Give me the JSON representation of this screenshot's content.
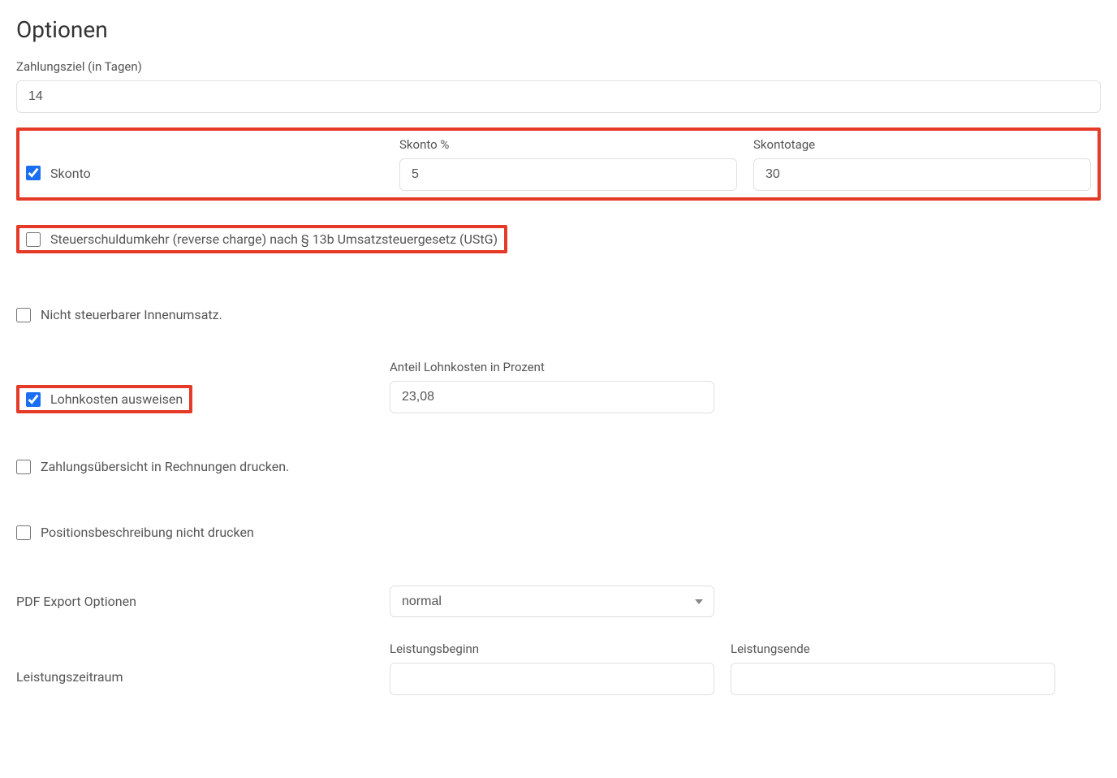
{
  "title": "Optionen",
  "zahlungsziel": {
    "label": "Zahlungsziel (in Tagen)",
    "value": "14"
  },
  "skonto": {
    "checkbox_label": "Skonto",
    "checked": true,
    "percent_label": "Skonto %",
    "percent_value": "5",
    "days_label": "Skontotage",
    "days_value": "30"
  },
  "reverse_charge": {
    "label": "Steuerschuldumkehr (reverse charge) nach § 13b Umsatzsteuergesetz (UStG)",
    "checked": false
  },
  "innenumsatz": {
    "label": "Nicht steuerbarer Innenumsatz.",
    "checked": false
  },
  "lohnkosten": {
    "checkbox_label": "Lohnkosten ausweisen",
    "checked": true,
    "percent_label": "Anteil Lohnkosten in Prozent",
    "percent_value": "23,08"
  },
  "zahlungsuebersicht": {
    "label": "Zahlungsübersicht in Rechnungen drucken.",
    "checked": false
  },
  "positionsbeschreibung": {
    "label": "Positionsbeschreibung nicht drucken",
    "checked": false
  },
  "pdf_export": {
    "label": "PDF Export Optionen",
    "value": "normal"
  },
  "leistungszeitraum": {
    "label": "Leistungszeitraum",
    "beginn_label": "Leistungsbeginn",
    "beginn_value": "",
    "ende_label": "Leistungsende",
    "ende_value": ""
  }
}
